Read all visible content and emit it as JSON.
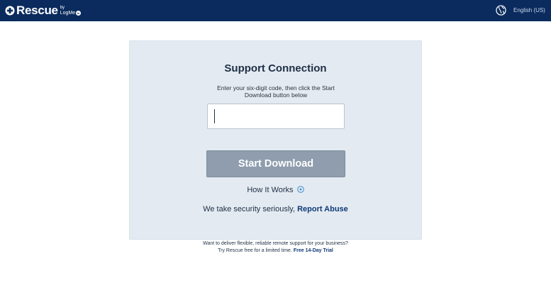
{
  "header": {
    "logo_word": "Rescue",
    "logo_by": "by",
    "logo_brand": "LogMe",
    "logo_brand_mark": "In",
    "language": "English (US)",
    "icons": {
      "logo": "plus-circle-icon",
      "globe": "globe-icon"
    },
    "background_color": "#0b2b5e"
  },
  "panel": {
    "title": "Support Connection",
    "instructions": "Enter your six-digit code, then click the Start Download button below",
    "code_input": {
      "value": "",
      "placeholder": ""
    },
    "start_button_label": "Start Download",
    "how_it_works_label": "How It Works",
    "how_it_works_icon": "chevron-circle-down-icon",
    "security_text": "We take security seriously, ",
    "report_abuse_label": "Report Abuse",
    "background_color": "#e3eaf1",
    "button_color": "#8f9dae",
    "link_color": "#0e3a78"
  },
  "promo": {
    "line1": "Want to deliver flexible, reliable remote support for your business?",
    "line2_text": "Try Rescue free for a limited time. ",
    "trial_link_label": "Free 14-Day Trial"
  }
}
